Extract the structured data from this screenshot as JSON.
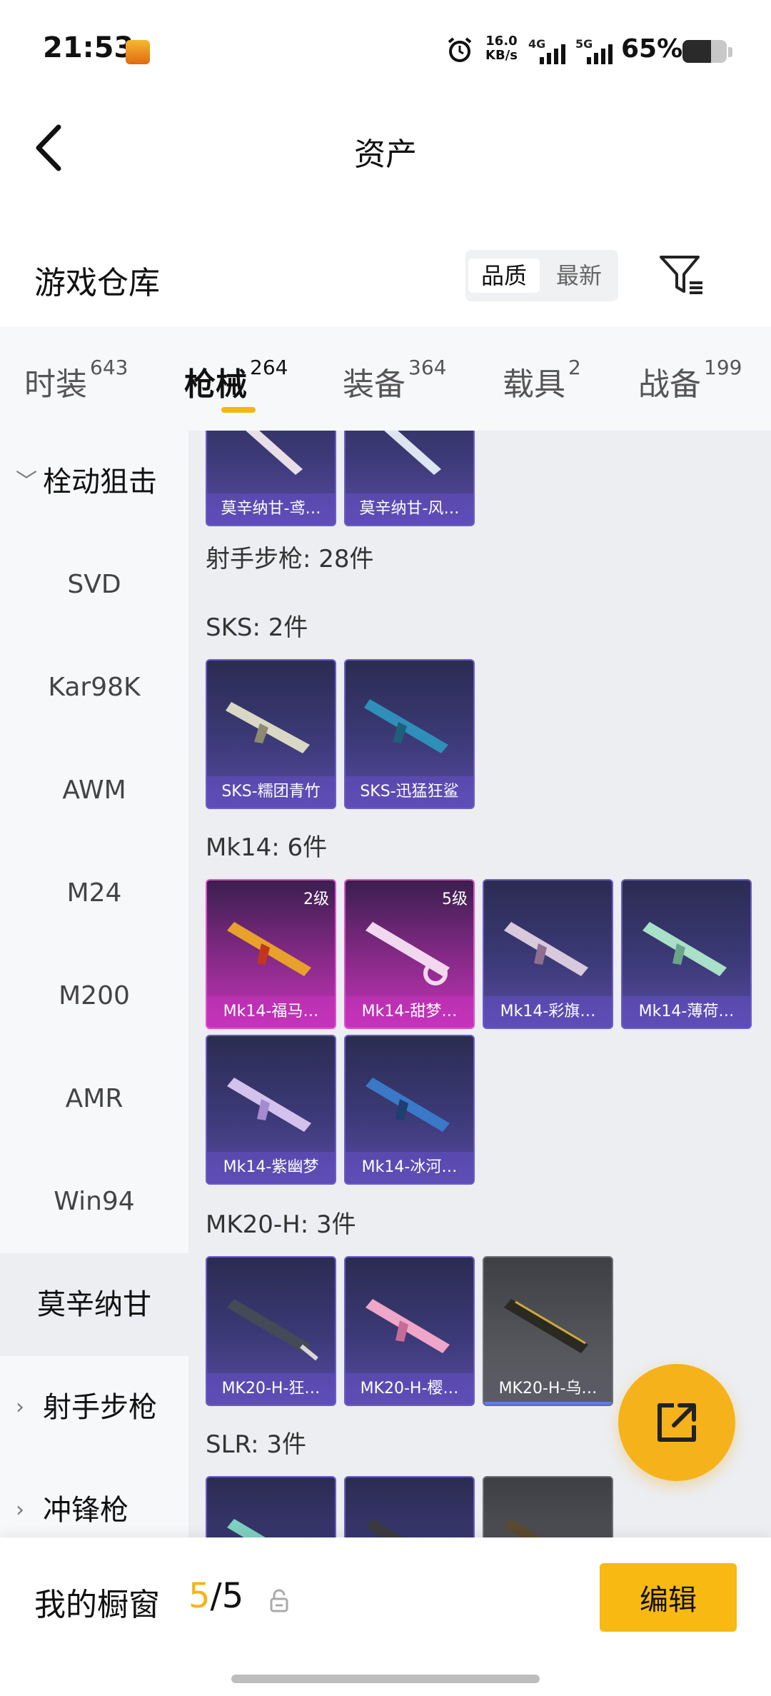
{
  "status_bar": {
    "time": "21:53",
    "net_speed_value": "16.0",
    "net_speed_unit": "KB/s",
    "sig1": "4G",
    "sig2": "5G",
    "battery": "65%",
    "battery_level": 0.65
  },
  "header": {
    "title": "资产"
  },
  "warehouse": {
    "title": "游戏仓库",
    "sort_options": [
      "品质",
      "最新"
    ],
    "sort_selected": "品质"
  },
  "tabs": [
    {
      "label": "时装",
      "count": "643"
    },
    {
      "label": "枪械",
      "count": "264"
    },
    {
      "label": "装备",
      "count": "364"
    },
    {
      "label": "载具",
      "count": "2"
    },
    {
      "label": "战备",
      "count": "199"
    }
  ],
  "active_tab": "枪械",
  "sidebar": {
    "items": [
      {
        "label": "栓动狙击",
        "type": "group"
      },
      {
        "label": "SVD"
      },
      {
        "label": "Kar98K"
      },
      {
        "label": "AWM"
      },
      {
        "label": "M24"
      },
      {
        "label": "M200"
      },
      {
        "label": "AMR"
      },
      {
        "label": "Win94"
      },
      {
        "label": "莫辛纳甘",
        "active": true
      },
      {
        "label": "射手步枪",
        "type": "group"
      },
      {
        "label": "冲锋枪",
        "type": "group"
      }
    ]
  },
  "main": {
    "top_cards": [
      "莫辛纳甘-鸢…",
      "莫辛纳甘-风…"
    ],
    "section_dmr": "射手步枪: 28件",
    "sks_title": "SKS: 2件",
    "sks_cards": [
      "SKS-糯团青竹",
      "SKS-迅猛狂鲨"
    ],
    "mk14_title": "Mk14: 6件",
    "mk14_cards": [
      {
        "name": "Mk14-福马…",
        "level": "2级"
      },
      {
        "name": "Mk14-甜梦…",
        "level": "5级"
      },
      {
        "name": "Mk14-彩旗…"
      },
      {
        "name": "Mk14-薄荷…"
      },
      {
        "name": "Mk14-紫幽梦"
      },
      {
        "name": "Mk14-冰河…"
      }
    ],
    "mk20_title": "MK20-H: 3件",
    "mk20_cards": [
      "MK20-H-狂…",
      "MK20-H-樱…",
      "MK20-H-乌…"
    ],
    "slr_title": "SLR: 3件"
  },
  "bottom": {
    "label": "我的橱窗",
    "current": "5",
    "sep": "/",
    "total": "5",
    "edit_label": "编辑"
  },
  "colors": {
    "accent": "#f6b21b",
    "card_purple": "#3c3a78",
    "card_pink": "#c236b8",
    "card_gray": "#55565c"
  }
}
